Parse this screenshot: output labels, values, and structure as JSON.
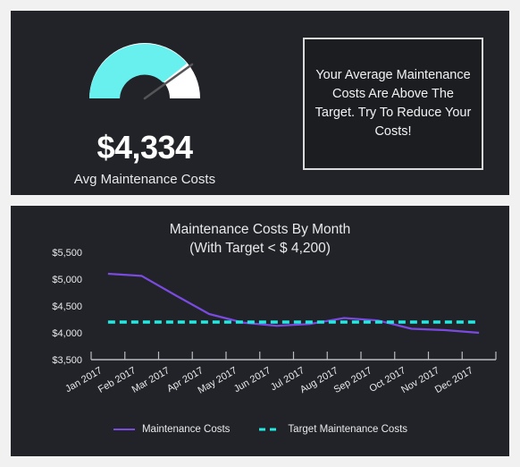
{
  "theme": {
    "page_background": "#f1f1f1",
    "panel_background": "#212328",
    "accent_cyan": "#68f0ef",
    "line_purple": "#7b4ae0",
    "target_cyan": "#25e8e0",
    "text_primary": "#ffffff",
    "text_secondary": "#e9e9ea"
  },
  "gauge": {
    "value_label": "$4,334",
    "caption": "Avg Maintenance Costs",
    "filled_fraction": 0.845,
    "needle_fraction": 0.845,
    "fill_color": "#68f0ef",
    "track_color": "#ffffff",
    "needle_color": "#555558"
  },
  "message": {
    "text": "Your Average Maintenance Costs Are Above The Target. Try To Reduce Your Costs!",
    "border_color": "#d9d9da"
  },
  "chart_panel": {
    "title": "Maintenance Costs By Month",
    "subtitle": "(With Target < $ 4,200)"
  },
  "legend": {
    "items": [
      {
        "label": "Maintenance Costs",
        "color": "#7b4ae0",
        "style": "solid"
      },
      {
        "label": "Target Maintenance Costs",
        "color": "#25e8e0",
        "style": "dashed"
      }
    ]
  },
  "chart_data": {
    "type": "line",
    "title": "Maintenance Costs By Month",
    "subtitle": "(With Target < $ 4,200)",
    "xlabel": "",
    "ylabel": "",
    "categories": [
      "Jan 2017",
      "Feb 2017",
      "Mar 2017",
      "Apr 2017",
      "May 2017",
      "Jun 2017",
      "Jul 2017",
      "Aug 2017",
      "Sep 2017",
      "Oct 2017",
      "Nov 2017",
      "Dec 2017"
    ],
    "ytick_labels": [
      "$5,500",
      "$5,000",
      "$4,500",
      "$4,000",
      "$3,500"
    ],
    "ytick_values": [
      5500,
      5000,
      4500,
      4000,
      3500
    ],
    "ylim": [
      3500,
      5500
    ],
    "grid": false,
    "legend_position": "bottom",
    "series": [
      {
        "name": "Maintenance Costs",
        "color": "#7b4ae0",
        "style": "solid",
        "values": [
          5100,
          5060,
          4700,
          4350,
          4190,
          4130,
          4165,
          4275,
          4230,
          4075,
          4050,
          4000
        ]
      },
      {
        "name": "Target Maintenance Costs",
        "color": "#25e8e0",
        "style": "dashed",
        "values": [
          4200,
          4200,
          4200,
          4200,
          4200,
          4200,
          4200,
          4200,
          4200,
          4200,
          4200,
          4200
        ]
      }
    ]
  }
}
